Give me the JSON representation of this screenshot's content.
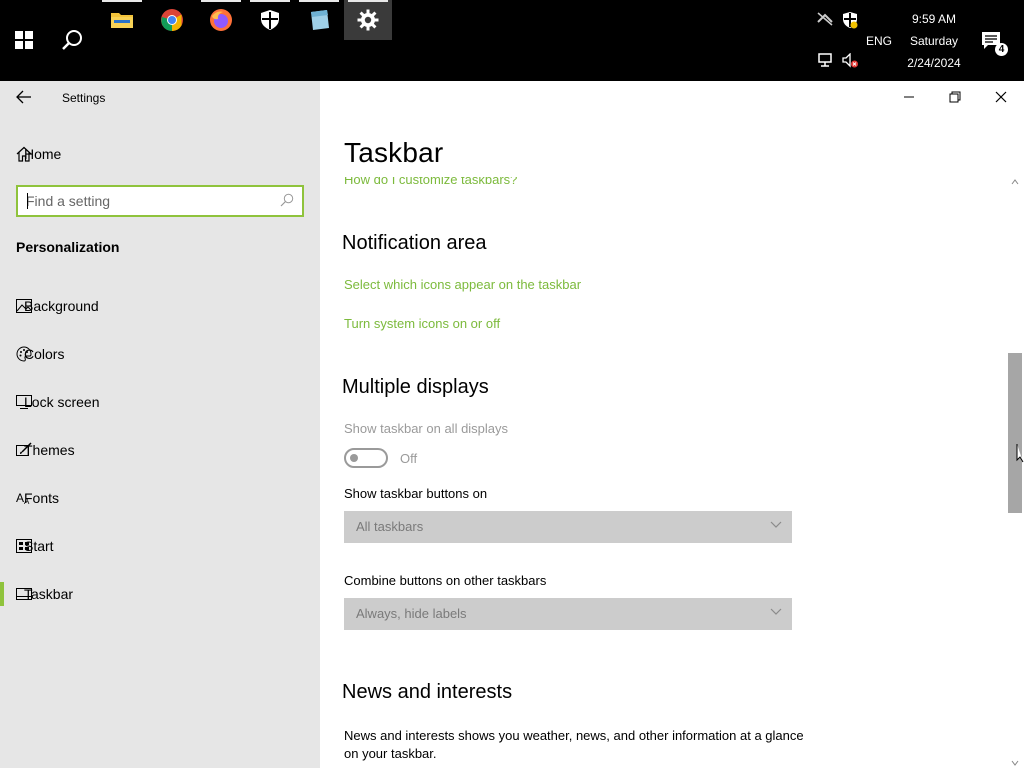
{
  "taskbar": {
    "apps": [
      {
        "name": "File Explorer",
        "icon": "folder-icon",
        "running": true
      },
      {
        "name": "Google Chrome",
        "icon": "chrome-icon",
        "running": false
      },
      {
        "name": "Firefox",
        "icon": "firefox-icon",
        "running": true
      },
      {
        "name": "Windows Security",
        "icon": "shield-icon",
        "running": true
      },
      {
        "name": "Notepad",
        "icon": "notepad-icon",
        "running": true
      },
      {
        "name": "Settings",
        "icon": "gear-icon",
        "running": true,
        "active": true
      }
    ],
    "language": "ENG",
    "clock": {
      "time": "9:59 AM",
      "day": "Saturday",
      "date": "2/24/2024"
    },
    "notification_count": "4"
  },
  "window": {
    "title": "Settings"
  },
  "sidebar": {
    "home": "Home",
    "search_placeholder": "Find a setting",
    "section": "Personalization",
    "items": [
      {
        "label": "Background",
        "icon": "image-icon"
      },
      {
        "label": "Colors",
        "icon": "palette-icon"
      },
      {
        "label": "Lock screen",
        "icon": "monitor-icon"
      },
      {
        "label": "Themes",
        "icon": "brush-icon"
      },
      {
        "label": "Fonts",
        "icon": "font-icon"
      },
      {
        "label": "Start",
        "icon": "start-icon"
      },
      {
        "label": "Taskbar",
        "icon": "taskbar-icon",
        "selected": true
      }
    ]
  },
  "content": {
    "title": "Taskbar",
    "customize_link": "How do I customize taskbars?",
    "notification_area": {
      "heading": "Notification area",
      "link1": "Select which icons appear on the taskbar",
      "link2": "Turn system icons on or off"
    },
    "multiple_displays": {
      "heading": "Multiple displays",
      "show_all_label": "Show taskbar on all displays",
      "toggle_state": "Off",
      "buttons_on_label": "Show taskbar buttons on",
      "buttons_on_value": "All taskbars",
      "combine_label": "Combine buttons on other taskbars",
      "combine_value": "Always, hide labels"
    },
    "news": {
      "heading": "News and interests",
      "description": "News and interests shows you weather, news, and other information at a glance on your taskbar."
    }
  },
  "colors": {
    "accent": "#8fc33c",
    "link": "#7cba3c",
    "sidebar_bg": "#e6e6e6",
    "taskbar_bg": "#000000"
  }
}
